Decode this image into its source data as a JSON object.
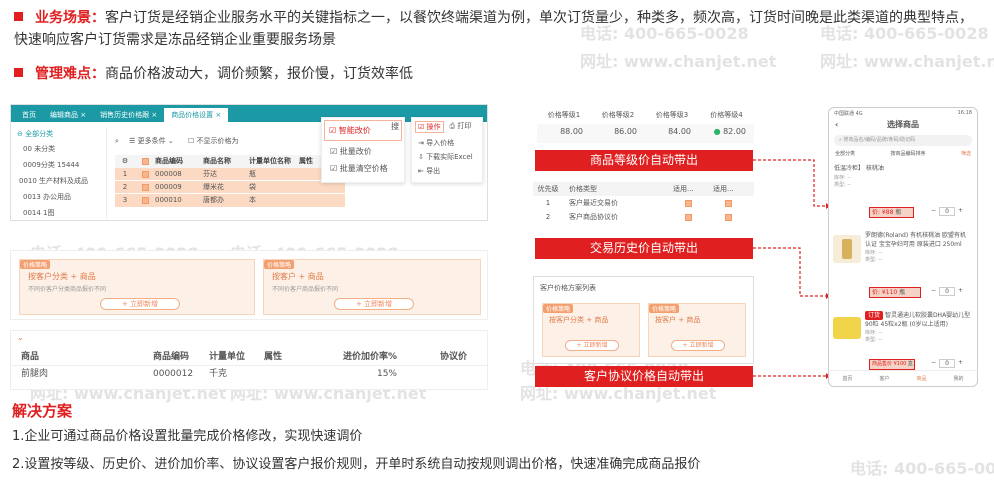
{
  "watermark": {
    "phone": "电话: 400-665-0028",
    "site": "网址: www.chanjet.net"
  },
  "bullets": [
    {
      "label": "业务场景：",
      "text": "客户订货是经销企业服务水平的关键指标之一，以餐饮终端渠道为例，单次订货量少，种类多，频次高，订货时间晚是此类渠道的典型特点，快速响应客户订货需求是冻品经销企业重要服务场景"
    },
    {
      "label": "管理难点：",
      "text": "商品价格波动大，调价频繁，报价慢，订货效率低"
    }
  ],
  "ribbons": {
    "grade": "商品等级价自动带出",
    "history": "交易历史价自动带出",
    "agreement": "客户协议价格自动带出"
  },
  "solution": {
    "title": "解决方案",
    "items": [
      "1.企业可通过商品价格设置批量完成价格修改，实现快速调价",
      "2.设置按等级、历史价、进价加价率、协议设置客户报价规则，开单时系统自动按规则调出价格，快速准确完成商品报价"
    ]
  },
  "ss1": {
    "tabs": [
      "首页",
      "编辑商品 ×",
      "销售历史价格跟 ×",
      "商品价格设置 ×"
    ],
    "sidebar_title": "全部分类",
    "sidebar_items": [
      "00 未分类",
      "0009分类 15444",
      "0010 生产材料及成品",
      "0013 办公用品",
      "0014 1图"
    ],
    "toolbar": {
      "more": "更多条件",
      "exclude": "不显示价格为"
    },
    "columns": [
      "",
      "",
      "商品编码",
      "商品名称",
      "计量单位名称",
      "属性"
    ],
    "rows": [
      [
        "1",
        "000008",
        "芬达",
        "瓶"
      ],
      [
        "2",
        "000009",
        "爆米花",
        "袋"
      ],
      [
        "3",
        "000010",
        "唐都办",
        "本"
      ]
    ],
    "popup1": {
      "btn1": "智能改价",
      "btn2": "批量改价",
      "btn3": "批量清空价格",
      "extra": "搜"
    },
    "popup2": {
      "title": "操作",
      "print": "打印",
      "items": [
        "导入价格",
        "下载实际Excel",
        "导出"
      ]
    }
  },
  "ss2": {
    "badges": [
      "价格策略",
      "价格策略"
    ],
    "left": "按客户分类 + 商品",
    "left_sub": "不同价客户分类商品报价不同",
    "right": "按客户 + 商品",
    "right_sub": "不同价客户商品报价不同",
    "add": "+ 立即新增"
  },
  "ss3": {
    "columns": [
      "商品",
      "商品编码",
      "计量单位",
      "属性",
      "进价加价率%",
      "协议价"
    ],
    "row": [
      "前腿肉",
      "0000012",
      "千克",
      "",
      "15%",
      ""
    ]
  },
  "grade_table": {
    "columns": [
      "价格等级1",
      "价格等级2",
      "价格等级3",
      "价格等级4"
    ],
    "values": [
      "88.00",
      "86.00",
      "84.00",
      "82.00"
    ]
  },
  "history_table": {
    "columns": [
      "优先级",
      "价格类型",
      "适用...",
      "适用..."
    ],
    "rows": [
      [
        "1",
        "客户最近交易价"
      ],
      [
        "2",
        "客户商品协议价"
      ]
    ]
  },
  "agreement_panel": {
    "title": "客户价格方案列表",
    "badge": "价格策略",
    "left": "按客户分类 + 商品",
    "right": "按客户 + 商品",
    "add": "+ 立即新增"
  },
  "phone": {
    "status": "中国联通 4G",
    "time": "16:18",
    "title": "选择商品",
    "search": "搜商品名/编码/品牌/条码/助记码",
    "cats": [
      "全部分类",
      "按商品编码排序",
      "筛选"
    ],
    "items": [
      {
        "name": "低温冷柜】 核桃油",
        "price": "价: ¥88",
        "unit": "瓶",
        "qty": "0",
        "tag": ""
      },
      {
        "name": "罗朗德(Roland) 有机核桃油 欧盟有机认证 宝宝孕妇可用 原装进口 250ml",
        "price": "价: ¥110",
        "unit": "瓶",
        "qty": "0",
        "tag": ""
      },
      {
        "name": "智灵通迪儿软胶囊DHA婴幼儿型90粒 45粒x2瓶 (0岁以上适用)",
        "price": "商品售价 ¥100",
        "unit": "盒",
        "qty": "0",
        "tag": "订货"
      }
    ],
    "label_stock": "库存: --",
    "label_kind": "类型: --",
    "nav": [
      "首页",
      "客户",
      "商品",
      "我的"
    ]
  }
}
